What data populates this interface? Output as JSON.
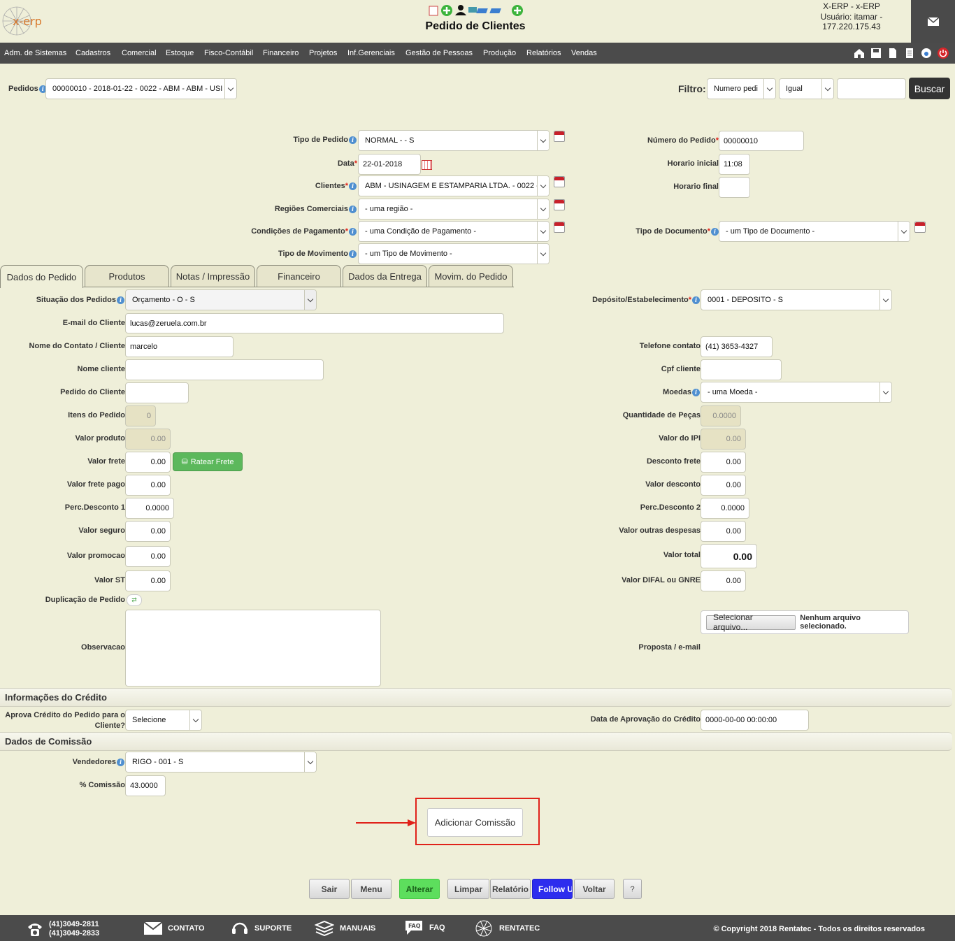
{
  "header": {
    "logo_text": "x-erp",
    "title": "Pedido de Clientes",
    "user_line1": "X-ERP - x-ERP",
    "user_line2": "Usuário: itamar -",
    "user_line3": "177.220.175.43",
    "mail_icon": "envelope-icon"
  },
  "menu": {
    "items": [
      "Adm. de Sistemas",
      "Cadastros",
      "Comercial",
      "Estoque",
      "Fisco-Contábil",
      "Financeiro",
      "Projetos",
      "Inf.Gerenciais",
      "Gestão de Pessoas",
      "Produção",
      "Relatórios",
      "Vendas"
    ],
    "icons": [
      "home-icon",
      "save-icon",
      "new-document-icon",
      "document-icon",
      "refresh-icon",
      "power-icon"
    ]
  },
  "pedidos": {
    "label": "Pedidos",
    "value": "00000010 - 2018-01-22 - 0022 - ABM - ABM - USI",
    "filtro_label": "Filtro:",
    "filtro_field": "Numero pedi",
    "filtro_op": "Igual",
    "filtro_value": "",
    "buscar": "Buscar"
  },
  "form": {
    "tipo_pedido_label": "Tipo de Pedido",
    "tipo_pedido": "NORMAL - - S",
    "data_label": "Data",
    "data": "22-01-2018",
    "clientes_label": "Clientes",
    "clientes": "ABM - USINAGEM E ESTAMPARIA LTDA. - 0022 - (",
    "regioes_label": "Regiões Comerciais",
    "regioes": "- uma região -",
    "cond_pag_label": "Condições de Pagamento",
    "cond_pag": "- uma Condição de Pagamento -",
    "tipo_mov_label": "Tipo de Movimento",
    "tipo_mov": "- um Tipo de Movimento -",
    "numero_pedido_label": "Número do Pedido",
    "numero_pedido": "00000010",
    "horario_inicial_label": "Horario inicial",
    "horario_inicial": "11:08",
    "horario_final_label": "Horario final",
    "horario_final": "",
    "tipo_doc_label": "Tipo de Documento",
    "tipo_doc": "- um Tipo de Documento -"
  },
  "tabs": [
    "Dados do Pedido",
    "Produtos",
    "Notas / Impressão",
    "Financeiro",
    "Dados da Entrega",
    "Movim. do Pedido"
  ],
  "dados": {
    "situacao_label": "Situação dos Pedidos",
    "situacao": "Orçamento - O - S",
    "deposito_label": "Depósito/Estabelecimento",
    "deposito": "0001 - DEPOSITO - S",
    "email_label": "E-mail do Cliente",
    "email": "lucas@zeruela.com.br",
    "contato_label": "Nome do Contato / Cliente",
    "contato": "marcelo",
    "telefone_label": "Telefone contato",
    "telefone": "(41) 3653-4327",
    "nome_cliente_label": "Nome cliente",
    "nome_cliente": "",
    "cpf_label": "Cpf cliente",
    "cpf": "",
    "pedido_cliente_label": "Pedido do Cliente",
    "pedido_cliente": "",
    "moedas_label": "Moedas",
    "moedas": "- uma Moeda -",
    "itens_label": "Itens do Pedido",
    "itens": "0",
    "qtd_pecas_label": "Quantidade de Peças",
    "qtd_pecas": "0.0000",
    "valor_produto_label": "Valor produto",
    "valor_produto": "0.00",
    "valor_ipi_label": "Valor do IPI",
    "valor_ipi": "0.00",
    "valor_frete_label": "Valor frete",
    "valor_frete": "0.00",
    "ratear_frete": "Ratear Frete",
    "desconto_frete_label": "Desconto frete",
    "desconto_frete": "0.00",
    "frete_pago_label": "Valor frete pago",
    "frete_pago": "0.00",
    "valor_desconto_label": "Valor desconto",
    "valor_desconto": "0.00",
    "perc_desc1_label": "Perc.Desconto 1",
    "perc_desc1": "0.0000",
    "perc_desc2_label": "Perc.Desconto 2",
    "perc_desc2": "0.0000",
    "valor_seguro_label": "Valor seguro",
    "valor_seguro": "0.00",
    "outras_desp_label": "Valor outras despesas",
    "outras_desp": "0.00",
    "valor_promocao_label": "Valor promocao",
    "valor_promocao": "0.00",
    "valor_total_label": "Valor total",
    "valor_total": "0.00",
    "valor_st_label": "Valor ST",
    "valor_st": "0.00",
    "difal_label": "Valor DIFAL ou GNRE",
    "difal": "0.00",
    "duplicacao_label": "Duplicação de Pedido",
    "observacao_label": "Observacao",
    "observacao": "",
    "selecionar_arquivo": "Selecionar arquivo...",
    "nenhum_arquivo": "Nenhum arquivo selecionado.",
    "proposta_label": "Proposta / e-mail"
  },
  "credito": {
    "section": "Informações do Crédito",
    "aprova_label_1": "Aprova Crédito do Pedido para o",
    "aprova_label_2": "Cliente?",
    "aprova": "Selecione",
    "data_aprov_label": "Data de Aprovação do Crédito",
    "data_aprov": "0000-00-00 00:00:00"
  },
  "comissao": {
    "section": "Dados de Comissão",
    "vendedores_label": "Vendedores",
    "vendedores": "RIGO - 001 - S",
    "perc_label": "% Comissão",
    "perc": "43.0000",
    "adicionar": "Adicionar Comissão"
  },
  "actions": [
    "Sair",
    "Menu",
    "Alterar",
    "Limpar",
    "Relatório",
    "Follow Up",
    "Voltar",
    "?"
  ],
  "footer": {
    "phone1": "(41)3049-2811",
    "phone2": "(41)3049-2833",
    "contato": "CONTATO",
    "suporte": "SUPORTE",
    "manuais": "MANUAIS",
    "faq": "FAQ",
    "rentatec": "RENTATEC",
    "copyright": "© Copyright 2018 Rentatec - Todos os direitos reservados"
  },
  "colors": {
    "background": "#efefd9",
    "menubar": "#4b4b4b",
    "required": "#e0221a",
    "ratear_green": "#5cb85c",
    "alterar_green": "#5dde5d",
    "followup_blue": "#2d2dee",
    "highlight_red": "#e0221a"
  }
}
